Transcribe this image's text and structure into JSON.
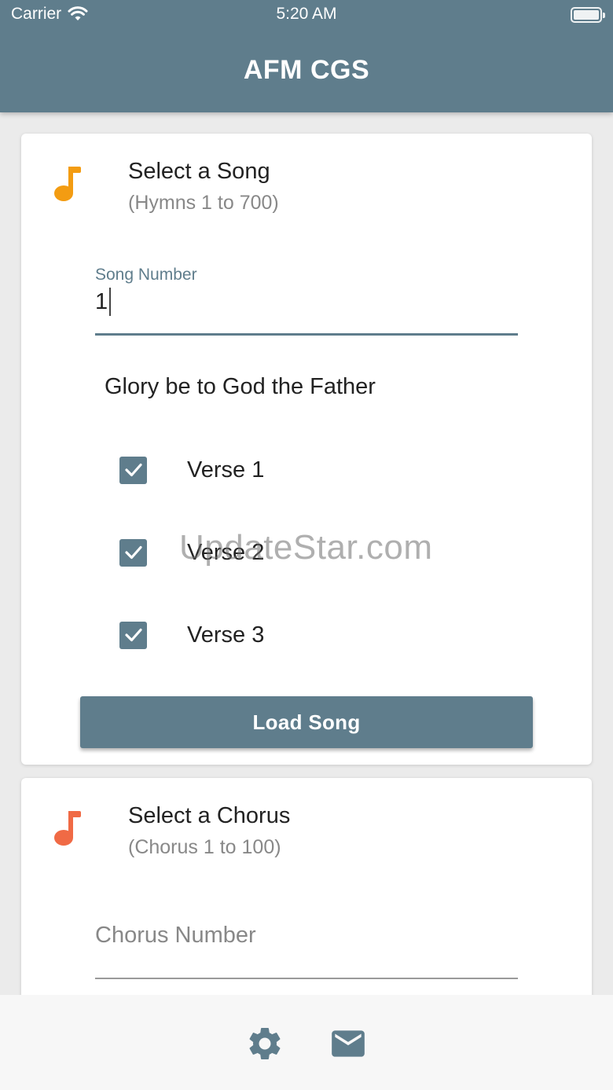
{
  "status_bar": {
    "carrier": "Carrier",
    "time": "5:20 AM"
  },
  "app_bar": {
    "title": "AFM CGS",
    "color": "#5f7d8c"
  },
  "song_card": {
    "icon": "music-note-icon",
    "icon_color": "#f39c12",
    "title": "Select a Song",
    "subtitle": "(Hymns 1 to 700)",
    "field_label": "Song Number",
    "field_value": "1",
    "song_name": "Glory be to God the Father",
    "verses": [
      {
        "label": "Verse 1",
        "checked": true
      },
      {
        "label": "Verse 2",
        "checked": true
      },
      {
        "label": "Verse 3",
        "checked": true
      }
    ],
    "button_label": "Load Song"
  },
  "chorus_card": {
    "icon": "music-note-icon",
    "icon_color": "#f06a45",
    "title": "Select a Chorus",
    "subtitle": "(Chorus 1 to 100)",
    "field_placeholder": "Chorus Number"
  },
  "watermark": "UpdateStar.com",
  "bottom_bar": {
    "icons": [
      "gear-icon",
      "mail-icon"
    ]
  }
}
